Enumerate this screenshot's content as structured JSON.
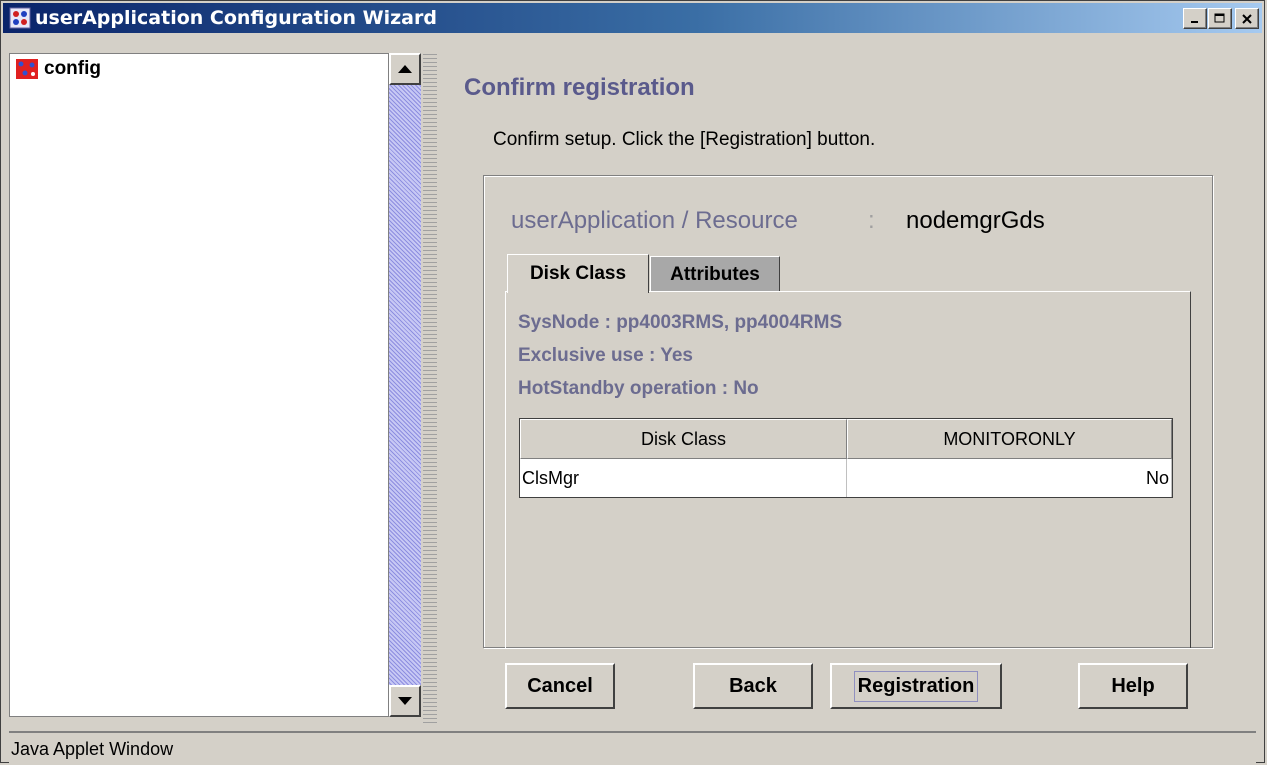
{
  "window": {
    "title": "userApplication Configuration Wizard",
    "icon": "app-icon"
  },
  "tree": {
    "root_label": "config",
    "root_icon": "folder-icon"
  },
  "main": {
    "heading": "Confirm registration",
    "instruction": "Confirm setup.  Click the [Registration] button.",
    "resource": {
      "label": "userApplication / Resource",
      "separator": ":",
      "value": "nodemgrGds"
    },
    "tabs": [
      {
        "label": "Disk Class",
        "active": true
      },
      {
        "label": "Attributes",
        "active": false
      }
    ],
    "info": {
      "sysnode": "SysNode : pp4003RMS, pp4004RMS",
      "exclusive": "Exclusive use : Yes",
      "hotstandby": "HotStandby operation : No"
    },
    "table": {
      "columns": [
        "Disk Class",
        "MONITORONLY"
      ],
      "rows": [
        [
          "ClsMgr",
          "No"
        ]
      ]
    },
    "buttons": {
      "cancel": "Cancel",
      "back": "Back",
      "registration": "Registration",
      "help": "Help"
    }
  },
  "statusbar": {
    "text": "Java Applet Window"
  }
}
